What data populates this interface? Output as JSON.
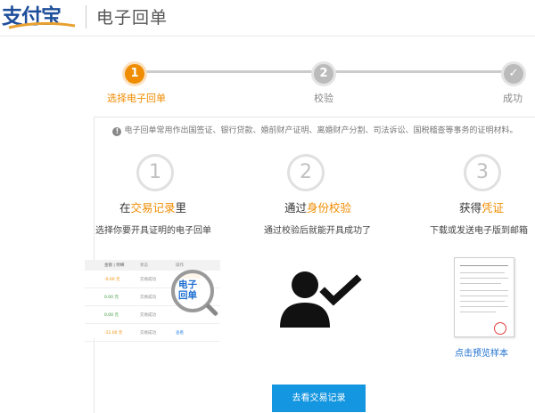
{
  "header": {
    "logo_text": "支付宝",
    "title": "电子回单"
  },
  "steps": [
    {
      "number": "1",
      "label": "选择电子回单",
      "status": "active"
    },
    {
      "number": "2",
      "label": "校验",
      "status": "pending"
    },
    {
      "number": "✓",
      "label": "成功",
      "status": "pending"
    }
  ],
  "notice": {
    "icon": "info-icon",
    "text": "电子回单常用作出国签证、银行贷款、婚前财产证明、离婚财产分割、司法诉讼、国税稽查等事务的证明材料。"
  },
  "columns": [
    {
      "number": "1",
      "title_prefix": "在",
      "title_highlight": "交易记录",
      "title_suffix": "里",
      "subtitle": "选择你要开具证明的电子回单"
    },
    {
      "number": "2",
      "title_prefix": "通过",
      "title_highlight": "身份校验",
      "title_suffix": "",
      "subtitle": "通过校验后就能开具成功了"
    },
    {
      "number": "3",
      "title_prefix": "获得",
      "title_highlight": "凭证",
      "title_suffix": "",
      "subtitle": "下载或发送电子版到邮箱"
    }
  ],
  "illustration": {
    "table_header": [
      "金额 | 明细",
      "状态",
      "操作"
    ],
    "table_rows": [
      [
        "-0.00 元",
        "交易成功",
        ""
      ],
      [
        "0.00 元",
        "交易成功",
        "查看"
      ],
      [
        "0.00 元",
        "交易成功",
        ""
      ],
      [
        "-11.00 元",
        "交易成功",
        "查看"
      ]
    ],
    "magnifier_label_line1": "电子",
    "magnifier_label_line2": "回单"
  },
  "preview_link": "点击预览样本",
  "primary_button": "去看交易记录",
  "colors": {
    "accent_orange": "#f08c00",
    "link_blue": "#1e6fd0",
    "button_blue": "#1596e0",
    "logo_blue": "#1e4e9a",
    "logo_orange": "#e8a030"
  }
}
